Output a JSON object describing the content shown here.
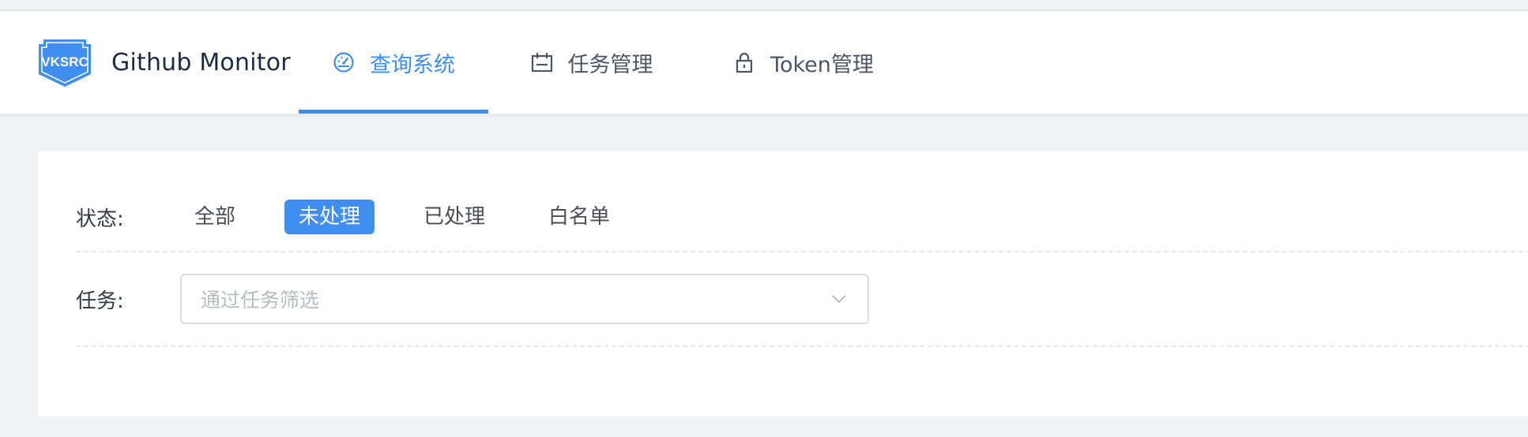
{
  "brand": {
    "logo_text": "VKSRC",
    "title": "Github Monitor"
  },
  "nav": [
    {
      "label": "查询系统",
      "icon": "dashboard-icon",
      "active": true
    },
    {
      "label": "任务管理",
      "icon": "calendar-icon",
      "active": false
    },
    {
      "label": "Token管理",
      "icon": "lock-icon",
      "active": false
    }
  ],
  "filters": {
    "status_label": "状态:",
    "status_options": [
      "全部",
      "未处理",
      "已处理",
      "白名单"
    ],
    "selected_status": "未处理",
    "task_label": "任务:",
    "task_placeholder": "通过任务筛选"
  },
  "colors": {
    "accent": "#3f8ef0",
    "background": "#f0f2f5"
  }
}
